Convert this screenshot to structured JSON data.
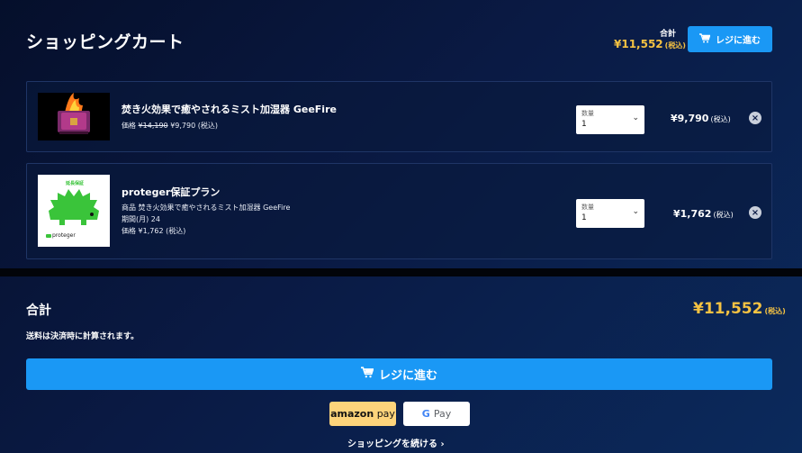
{
  "header": {
    "title": "ショッピングカート",
    "total_label": "合計",
    "total_value": "¥11,552",
    "tax_note": "(税込)",
    "checkout_label": "レジに進む"
  },
  "items": [
    {
      "name": "焚き火効果で癒やされるミスト加湿器 GeeFire",
      "price_prefix": "価格",
      "original_price": "¥14,190",
      "price": "¥9,790 (税込)",
      "qty_label": "数量",
      "qty_value": "1",
      "line_total": "¥9,790",
      "tax_note": "(税込)"
    },
    {
      "name": "proteger保証プラン",
      "product_line": "商品 焚き火効果で癒やされるミスト加湿器 GeeFire",
      "period_line": "期間(月) 24",
      "price_line": "価格 ¥1,762 (税込)",
      "thumb_top": "延長保証",
      "thumb_brand": "proteger",
      "qty_label": "数量",
      "qty_value": "1",
      "line_total": "¥1,762",
      "tax_note": "(税込)"
    }
  ],
  "summary": {
    "total_label": "合計",
    "total_value": "¥11,552",
    "tax_note": "(税込)",
    "shipping_note": "送料は決済時に計算されます。",
    "checkout_label": "レジに進む"
  },
  "payments": {
    "amazon_a": "amazon",
    "amazon_b": "pay",
    "gpay_g": "G",
    "gpay_label": "Pay"
  },
  "continue_label": "ショッピングを続ける",
  "colors": {
    "accent": "#1a98f5",
    "price": "#f5c242",
    "amazon": "#fdd47b"
  }
}
